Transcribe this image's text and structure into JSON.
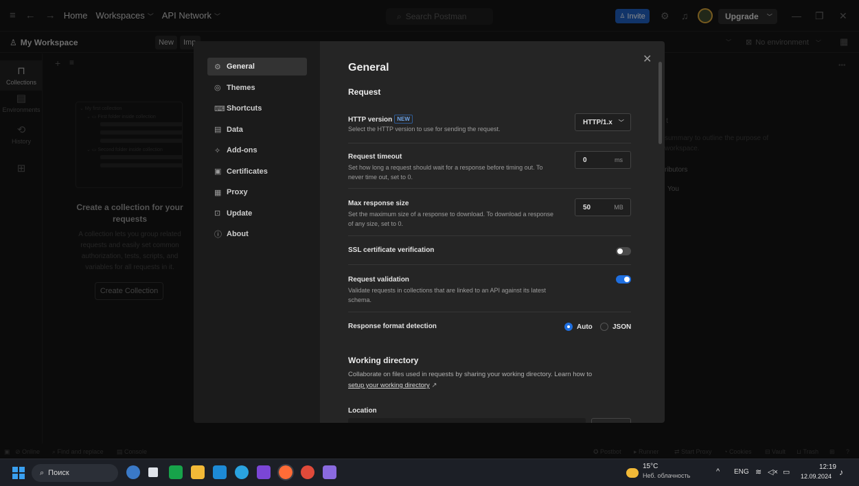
{
  "topbar": {
    "nav": [
      {
        "label": "Home",
        "has_caret": false
      },
      {
        "label": "Workspaces",
        "has_caret": true
      },
      {
        "label": "API Network",
        "has_caret": true
      }
    ],
    "search_placeholder": "Search Postman",
    "invite_label": "Invite",
    "upgrade_label": "Upgrade"
  },
  "workspace": {
    "name": "My Workspace",
    "new_label": "New",
    "import_label": "Imp",
    "environment_label": "No environment"
  },
  "rail": {
    "collections": "Collections",
    "environments": "Environments",
    "history": "History"
  },
  "sidebar": {
    "illustration": {
      "collection": "My first collection",
      "folder1": "First folder inside collection",
      "folder2": "Second folder inside collection"
    },
    "empty_title": "Create a collection for your requests",
    "empty_desc": "A collection lets you group related requests and easily set common authorization, tests, scripts, and variables for all requests in it.",
    "create_button": "Create Collection"
  },
  "background_right": {
    "overview_fragment": "t",
    "summary_fragment": "summary to outline the purpose of",
    "workspace_fragment": "workspace.",
    "contributors_fragment": "ributors",
    "you": "You"
  },
  "statusbar": {
    "online": "Online",
    "find_replace": "Find and replace",
    "console": "Console",
    "right_items": [
      "Postbot",
      "Runner",
      "Start Proxy",
      "Cookies",
      "Vault",
      "Trash"
    ]
  },
  "settings": {
    "nav": [
      {
        "label": "General",
        "icon": "gear-icon",
        "glyph": "⚙",
        "active": true
      },
      {
        "label": "Themes",
        "icon": "palette-icon",
        "glyph": "◎",
        "active": false
      },
      {
        "label": "Shortcuts",
        "icon": "keyboard-icon",
        "glyph": "⌨",
        "active": false
      },
      {
        "label": "Data",
        "icon": "database-icon",
        "glyph": "▤",
        "active": false
      },
      {
        "label": "Add-ons",
        "icon": "sparkle-icon",
        "glyph": "✧",
        "active": false
      },
      {
        "label": "Certificates",
        "icon": "certificate-icon",
        "glyph": "▣",
        "active": false
      },
      {
        "label": "Proxy",
        "icon": "proxy-icon",
        "glyph": "▦",
        "active": false
      },
      {
        "label": "Update",
        "icon": "update-icon",
        "glyph": "⊡",
        "active": false
      },
      {
        "label": "About",
        "icon": "info-icon",
        "glyph": "ⓘ",
        "active": false
      }
    ],
    "title": "General",
    "request_heading": "Request",
    "http_version": {
      "label": "HTTP version",
      "badge": "NEW",
      "desc": "Select the HTTP version to use for sending the request.",
      "value": "HTTP/1.x"
    },
    "request_timeout": {
      "label": "Request timeout",
      "desc": "Set how long a request should wait for a response before timing out. To never time out, set to 0.",
      "value": "0",
      "unit": "ms"
    },
    "max_response_size": {
      "label": "Max response size",
      "desc": "Set the maximum size of a response to download. To download a response of any size, set to 0.",
      "value": "50",
      "unit": "MB"
    },
    "ssl_verification": {
      "label": "SSL certificate verification",
      "enabled": false
    },
    "request_validation": {
      "label": "Request validation",
      "desc": "Validate requests in collections that are linked to an API against its latest schema.",
      "enabled": true
    },
    "response_format": {
      "label": "Response format detection",
      "options": [
        "Auto",
        "JSON"
      ],
      "selected": "Auto"
    },
    "working_directory": {
      "heading": "Working directory",
      "desc": "Collaborate on files used in requests by sharing your working directory. Learn how to",
      "link": "setup your working directory",
      "link_icon": "↗"
    },
    "location_label": "Location"
  },
  "taskbar": {
    "search": "Поиск",
    "temperature": "15°C",
    "weather": "Неб. облачность",
    "language": "ENG",
    "time": "12:19",
    "date": "12.09.2024"
  },
  "colors": {
    "accent_blue": "#1f6fe0",
    "postman_orange": "#ff6c37",
    "dialog_bg": "#252525"
  }
}
